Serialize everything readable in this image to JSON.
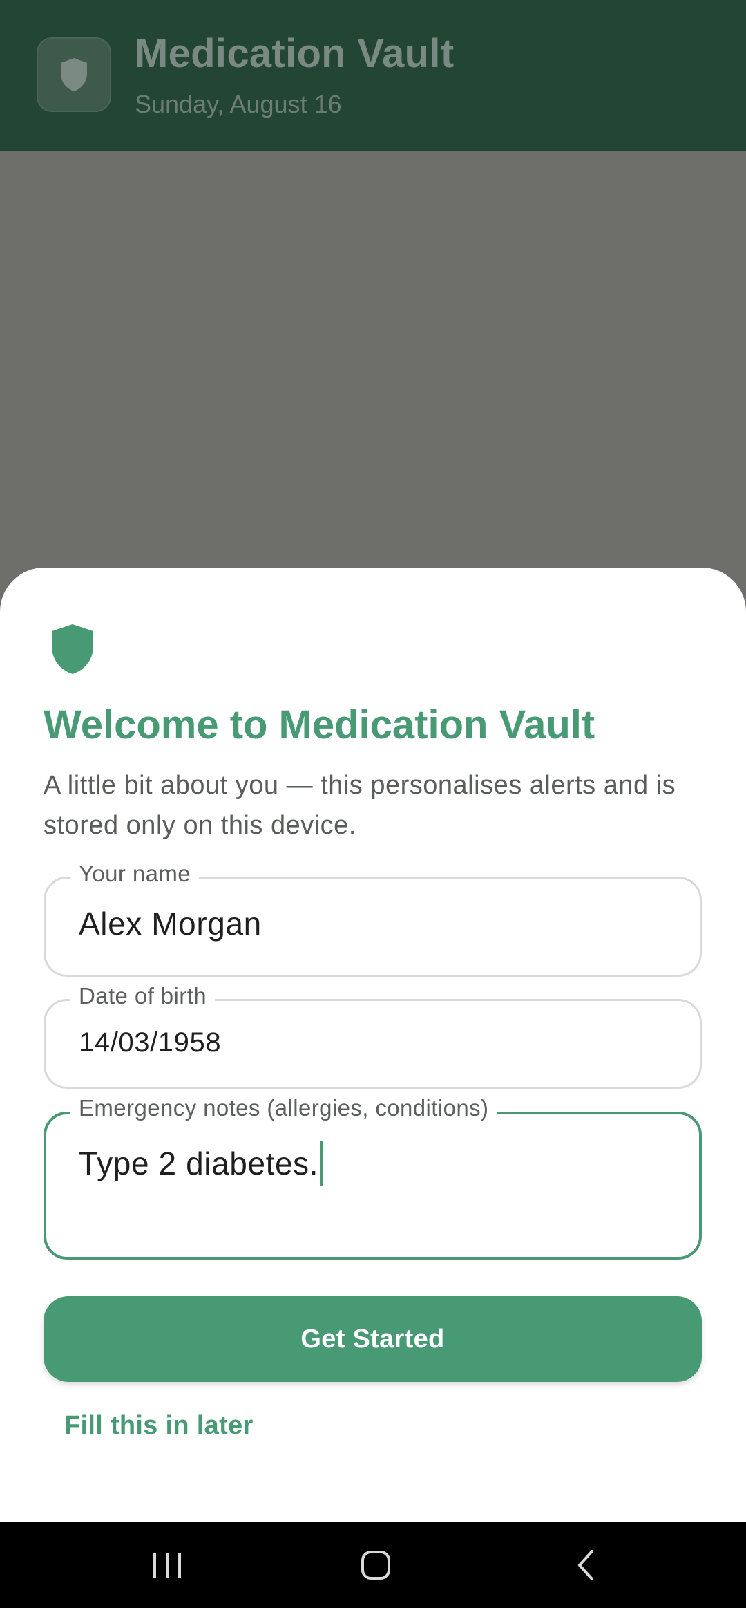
{
  "header": {
    "title": "Medication Vault",
    "date": "Sunday, August 16",
    "logo_icon": "shield-icon"
  },
  "sheet": {
    "icon": "shield-icon",
    "title": "Welcome to Medication Vault",
    "description": "A little bit about you — this personalises alerts and is stored only on this device.",
    "fields": {
      "name": {
        "label": "Your name",
        "value": "Alex Morgan"
      },
      "dob": {
        "label": "Date of birth",
        "value": "14/03/1958"
      },
      "notes": {
        "label": "Emergency notes (allergies, conditions)",
        "value": "Type 2 diabetes.",
        "focused": true
      }
    },
    "primary_button": "Get Started",
    "secondary_button": "Fill this in later"
  },
  "nav": {
    "recents_icon": "recents-icon",
    "home_icon": "home-icon",
    "back_icon": "back-icon"
  },
  "colors": {
    "accent": "#479a73",
    "header_bg": "#234534",
    "scrim": "#6e6f6b",
    "nav_bg": "#000000"
  }
}
